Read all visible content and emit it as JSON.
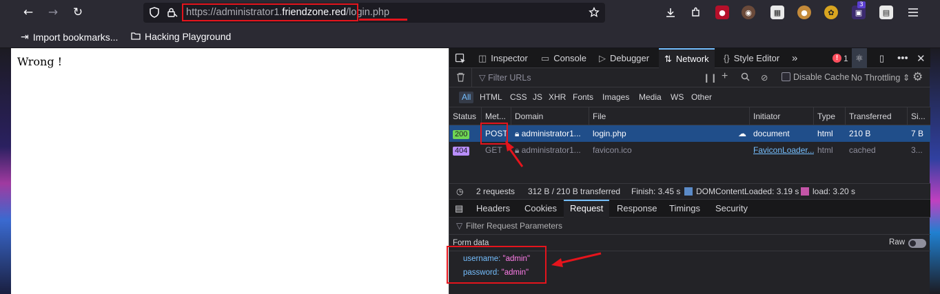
{
  "browser": {
    "url_prefix": "https://administrator1.",
    "url_host": "friendzone.red",
    "url_path": "/login.php",
    "nav": {
      "back_icon": "←",
      "forward_icon": "→",
      "reload_icon": "↻"
    },
    "extension_badge": "3"
  },
  "bookmarks": [
    {
      "label": "Import bookmarks..."
    },
    {
      "label": "Hacking Playground"
    }
  ],
  "page": {
    "text": "Wrong !"
  },
  "devtools": {
    "tabs": [
      {
        "label": "Inspector"
      },
      {
        "label": "Console"
      },
      {
        "label": "Debugger"
      },
      {
        "label": "Network"
      },
      {
        "label": "Style Editor"
      }
    ],
    "error_count": "1",
    "filter_placeholder": "Filter URLs",
    "disable_cache": "Disable Cache",
    "throttling": "No Throttling",
    "type_filters": [
      "All",
      "HTML",
      "CSS",
      "JS",
      "XHR",
      "Fonts",
      "Images",
      "Media",
      "WS",
      "Other"
    ],
    "columns": [
      "Status",
      "Met...",
      "Domain",
      "File",
      "Initiator",
      "Type",
      "Transferred",
      "Si..."
    ],
    "requests": [
      {
        "status": "200",
        "method": "POST",
        "domain": "administrator1...",
        "file": "login.php",
        "initiator": "document",
        "type": "html",
        "transferred": "210 B",
        "size": "7 B"
      },
      {
        "status": "404",
        "method": "GET",
        "domain": "administrator1...",
        "file": "favicon.ico",
        "initiator": "FaviconLoader...",
        "type": "html",
        "transferred": "cached",
        "size": "3..."
      }
    ],
    "summary": {
      "requests": "2 requests",
      "transferred": "312 B / 210 B transferred",
      "finish": "Finish: 3.45 s",
      "dom_loaded": "DOMContentLoaded: 3.19 s",
      "load": "load: 3.20 s"
    },
    "detail_tabs": [
      "Headers",
      "Cookies",
      "Request",
      "Response",
      "Timings",
      "Security"
    ],
    "param_filter": "Filter Request Parameters",
    "form_title": "Form data",
    "raw_label": "Raw",
    "form_data": [
      {
        "key": "username:",
        "value": "\"admin\""
      },
      {
        "key": "password:",
        "value": "\"admin\""
      }
    ]
  },
  "colors": {
    "annotation_red": "#e5141c",
    "selected_row": "#204e8a",
    "status_200": "#6fd654",
    "status_404": "#b98eff"
  }
}
